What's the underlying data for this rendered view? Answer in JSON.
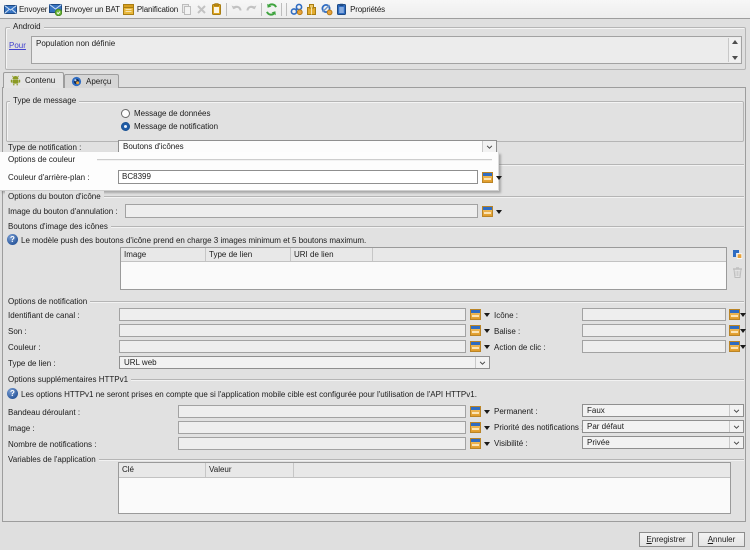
{
  "toolbar": {
    "send_label": "Envoyer",
    "send_proof_label": "Envoyer un BAT",
    "schedule_label": "Planification",
    "properties_label": "Propriétés"
  },
  "android_box": {
    "title": "Android",
    "target_link_label": "Pour",
    "population_value": "Population non définie"
  },
  "tabs": {
    "content_label": "Contenu",
    "preview_label": "Aperçu"
  },
  "message_type": {
    "group_title": "Type de message",
    "radio_data_label": "Message de données",
    "radio_notification_label": "Message de notification"
  },
  "notification_type": {
    "label": "Type de notification :",
    "value": "Boutons d'icônes"
  },
  "color_options": {
    "group_title": "Options de couleur",
    "background_color_label": "Couleur d'arrière-plan :",
    "background_color_value": "BC8399"
  },
  "icon_button_options": {
    "group_title": "Options du bouton d'icône",
    "cancel_button_image_label": "Image du bouton d'annulation :",
    "cancel_button_image_value": ""
  },
  "icon_image_buttons": {
    "group_title": "Boutons d'image des icônes",
    "info_text": "Le modèle push des boutons d'icône prend en charge 3 images minimum et 5 boutons maximum.",
    "columns": [
      "Image",
      "Type de lien",
      "URI de lien"
    ]
  },
  "notification_options": {
    "group_title": "Options de notification",
    "left_rows": [
      {
        "label": "Identifiant de canal :",
        "value": ""
      },
      {
        "label": "Son :",
        "value": ""
      },
      {
        "label": "Couleur :",
        "value": ""
      }
    ],
    "link_type_label": "Type de lien :",
    "link_type_value": "URL web",
    "right_rows": [
      {
        "label": "Icône :",
        "value": ""
      },
      {
        "label": "Balise :",
        "value": ""
      },
      {
        "label": "Action de clic :",
        "value": ""
      }
    ]
  },
  "httpv1_options": {
    "group_title": "Options supplémentaires HTTPv1",
    "info_text": "Les options HTTPv1 ne seront prises en compte que si l'application mobile cible est configurée pour l'utilisation de l'API HTTPv1.",
    "left_rows": [
      {
        "label": "Bandeau déroulant :",
        "value": ""
      },
      {
        "label": "Image :",
        "value": ""
      },
      {
        "label": "Nombre de notifications :",
        "value": ""
      }
    ],
    "right_rows": [
      {
        "label": "Permanent :",
        "value": "Faux"
      },
      {
        "label": "Priorité des notifications :",
        "value": "Par défaut"
      },
      {
        "label": "Visibilité :",
        "value": "Privée"
      }
    ]
  },
  "app_variables": {
    "group_title": "Variables de l'application",
    "columns": [
      "Clé",
      "Valeur"
    ]
  },
  "footer": {
    "save_label": "Enregistrer",
    "cancel_label": "Annuler"
  },
  "colors": {
    "accent_blue": "#2f6cc2",
    "accent_orange": "#e09c2a",
    "window_bg": "#e0e0e0",
    "popup_bg": "#fdfdfd",
    "link": "#4343cf"
  }
}
